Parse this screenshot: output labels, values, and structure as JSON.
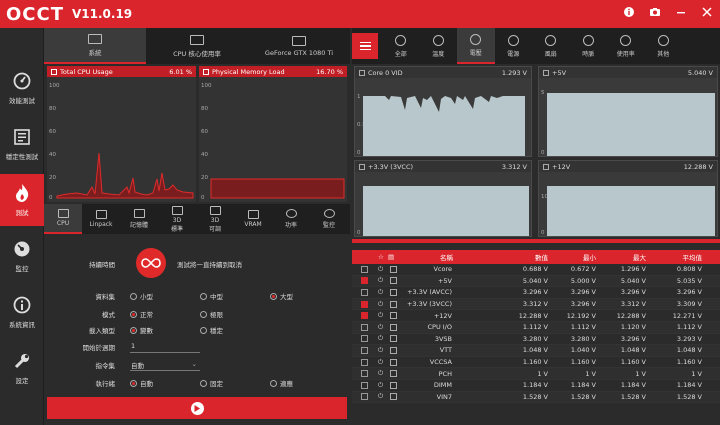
{
  "app": {
    "logo": "OCCT",
    "version": "V11.0.19"
  },
  "titlebar_icons": [
    "info-icon",
    "camera-icon",
    "minimize-icon",
    "close-icon"
  ],
  "sidebar": {
    "items": [
      {
        "label": "效能測試",
        "icon": "speedometer-icon"
      },
      {
        "label": "穩定性測試",
        "icon": "checklist-icon"
      },
      {
        "label": "測試",
        "icon": "flame-icon",
        "active": true
      },
      {
        "label": "監控",
        "icon": "dashboard-icon"
      },
      {
        "label": "系統資訊",
        "icon": "info-icon"
      },
      {
        "label": "設定",
        "icon": "wrench-icon"
      }
    ]
  },
  "left_tabs": [
    {
      "label": "系統",
      "active": true
    },
    {
      "label": "CPU 核心使用率"
    },
    {
      "label": "GeForce GTX 1080 Ti"
    }
  ],
  "cpu_graph": {
    "title": "Total CPU Usage",
    "value": "6.01 %",
    "ticks": [
      "100",
      "80",
      "60",
      "40",
      "20",
      "0"
    ]
  },
  "mem_graph": {
    "title": "Physical Memory Load",
    "value": "16.70 %",
    "ticks": [
      "100",
      "80",
      "60",
      "40",
      "20",
      "0"
    ]
  },
  "test_tabs": [
    {
      "label": "CPU",
      "active": true
    },
    {
      "label": "Linpack"
    },
    {
      "label": "記憶體"
    },
    {
      "label": "3D\n標準"
    },
    {
      "label": "3D\n可調"
    },
    {
      "label": "VRAM"
    },
    {
      "label": "功率"
    },
    {
      "label": "監控"
    }
  ],
  "form": {
    "duration_label": "持續時間",
    "duration_text": "測試將一直持續到取消",
    "dataset_label": "資料集",
    "dataset_options": [
      "小型",
      "中型",
      "大型"
    ],
    "dataset_selected": 2,
    "mode_label": "模式",
    "mode_options": [
      "正常",
      "極限"
    ],
    "mode_selected": 0,
    "load_label": "載入類型",
    "load_options": [
      "變數",
      "穩定"
    ],
    "load_selected": 0,
    "cycle_label": "開始於週期",
    "cycle_value": "1",
    "instr_label": "指令集",
    "instr_value": "自動",
    "thread_label": "執行緒",
    "thread_options": [
      "自動",
      "固定",
      "適應"
    ],
    "thread_selected": 0
  },
  "right_tabs": [
    {
      "label": "全部"
    },
    {
      "label": "溫度"
    },
    {
      "label": "電壓",
      "active": true
    },
    {
      "label": "電源"
    },
    {
      "label": "風扇"
    },
    {
      "label": "時脈"
    },
    {
      "label": "使用率"
    },
    {
      "label": "其他"
    }
  ],
  "vgraphs": [
    {
      "title": "Core 0 VID",
      "value": "1.293 V",
      "ticks": [
        "1",
        "0.5",
        "0"
      ]
    },
    {
      "title": "+5V",
      "value": "5.040 V",
      "ticks": [
        "5",
        "0"
      ]
    },
    {
      "title": "+3.3V (3VCC)",
      "value": "3.312 V",
      "ticks": [
        "0"
      ]
    },
    {
      "title": "+12V",
      "value": "12.288 V",
      "ticks": [
        "10",
        "0"
      ]
    }
  ],
  "table": {
    "headers": {
      "name": "名稱",
      "value": "數值",
      "min": "最小",
      "max": "最大",
      "avg": "平均值"
    },
    "rows": [
      {
        "checked": false,
        "name": "Vcore",
        "value": "0.688 V",
        "min": "0.672 V",
        "max": "1.296 V",
        "avg": "0.808 V"
      },
      {
        "checked": true,
        "name": "+5V",
        "value": "5.040 V",
        "min": "5.000 V",
        "max": "5.040 V",
        "avg": "5.035 V"
      },
      {
        "checked": false,
        "name": "+3.3V (AVCC)",
        "value": "3.296 V",
        "min": "3.296 V",
        "max": "3.296 V",
        "avg": "3.296 V"
      },
      {
        "checked": true,
        "name": "+3.3V (3VCC)",
        "value": "3.312 V",
        "min": "3.296 V",
        "max": "3.312 V",
        "avg": "3.309 V"
      },
      {
        "checked": true,
        "name": "+12V",
        "value": "12.288 V",
        "min": "12.192 V",
        "max": "12.288 V",
        "avg": "12.271 V"
      },
      {
        "checked": false,
        "name": "CPU I/O",
        "value": "1.112 V",
        "min": "1.112 V",
        "max": "1.120 V",
        "avg": "1.112 V"
      },
      {
        "checked": false,
        "name": "3VSB",
        "value": "3.280 V",
        "min": "3.280 V",
        "max": "3.296 V",
        "avg": "3.293 V"
      },
      {
        "checked": false,
        "name": "VTT",
        "value": "1.048 V",
        "min": "1.040 V",
        "max": "1.048 V",
        "avg": "1.048 V"
      },
      {
        "checked": false,
        "name": "VCCSA",
        "value": "1.160 V",
        "min": "1.160 V",
        "max": "1.160 V",
        "avg": "1.160 V"
      },
      {
        "checked": false,
        "name": "PCH",
        "value": "1 V",
        "min": "1 V",
        "max": "1 V",
        "avg": "1 V"
      },
      {
        "checked": false,
        "name": "DIMM",
        "value": "1.184 V",
        "min": "1.184 V",
        "max": "1.184 V",
        "avg": "1.184 V"
      },
      {
        "checked": false,
        "name": "VIN7",
        "value": "1.528 V",
        "min": "1.528 V",
        "max": "1.528 V",
        "avg": "1.528 V"
      }
    ]
  },
  "colors": {
    "accent": "#d9252b",
    "bg": "#2b2b2b",
    "panel": "#1f1f1f",
    "graph_fill": "#b8c7cc"
  }
}
